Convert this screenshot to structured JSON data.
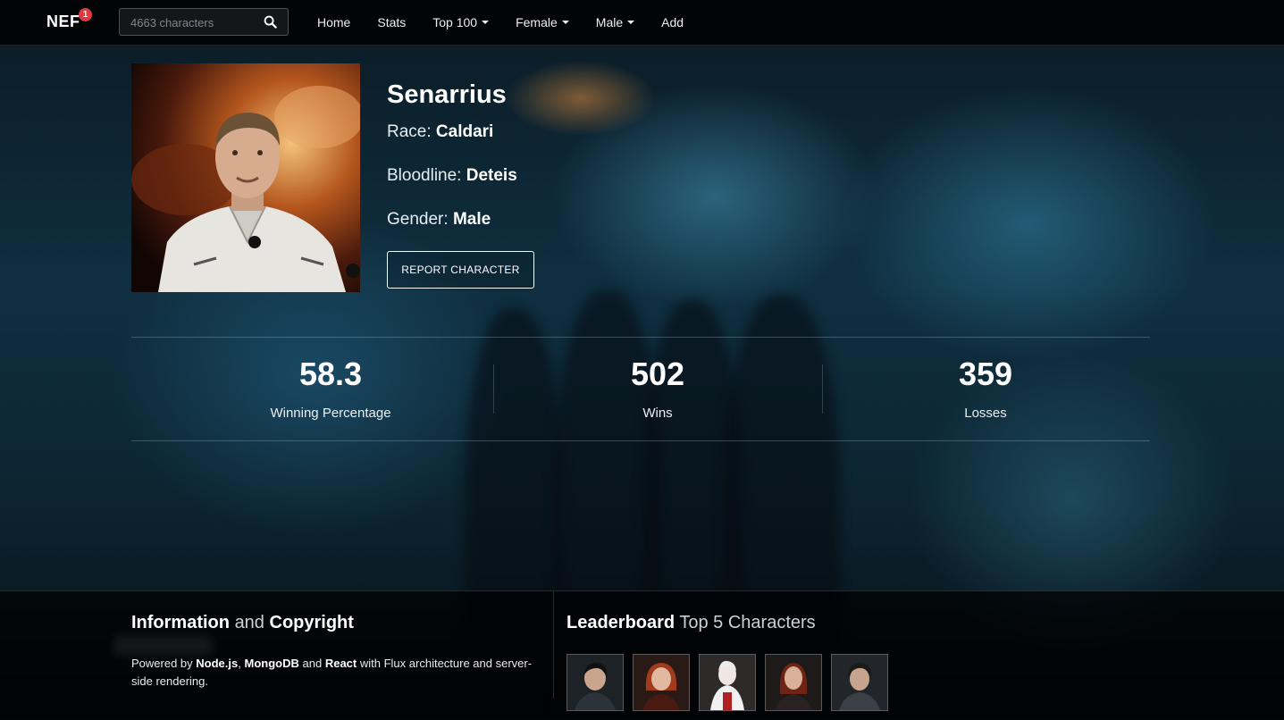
{
  "navbar": {
    "brand": "NEF",
    "badge_count": "1",
    "search_placeholder": "4663 characters",
    "items": [
      {
        "label": "Home",
        "dropdown": false
      },
      {
        "label": "Stats",
        "dropdown": false
      },
      {
        "label": "Top 100",
        "dropdown": true
      },
      {
        "label": "Female",
        "dropdown": true
      },
      {
        "label": "Male",
        "dropdown": true
      },
      {
        "label": "Add",
        "dropdown": false
      }
    ]
  },
  "profile": {
    "name": "Senarrius",
    "race_label": "Race:",
    "race": "Caldari",
    "bloodline_label": "Bloodline:",
    "bloodline": "Deteis",
    "gender_label": "Gender:",
    "gender": "Male",
    "report_button": "REPORT CHARACTER"
  },
  "stats": {
    "winning_percentage": "58.3",
    "winning_percentage_label": "Winning Percentage",
    "wins": "502",
    "wins_label": "Wins",
    "losses": "359",
    "losses_label": "Losses"
  },
  "footer": {
    "info_title_bold1": "Information",
    "info_title_mid": "and",
    "info_title_bold2": "Copyright",
    "powered_by": "Powered by",
    "tech1": "Node.js",
    "comma": ",",
    "tech2": "MongoDB",
    "and": "and",
    "tech3": "React",
    "rest": "with Flux architecture and server-side rendering.",
    "leader_title_bold": "Leaderboard",
    "leader_title_rest": "Top 5 Characters"
  },
  "colors": {
    "badge": "#e0393e",
    "navbar_bg": "#000000"
  }
}
